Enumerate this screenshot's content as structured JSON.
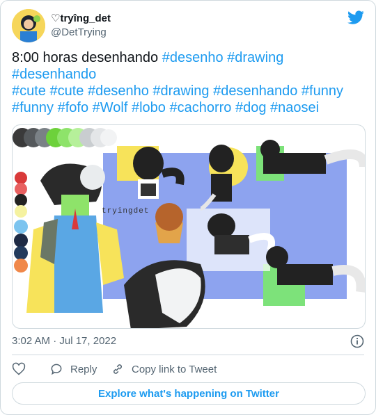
{
  "author": {
    "display_name": "♡tryîng_det",
    "handle": "@DetTrying"
  },
  "tweet": {
    "lines": [
      {
        "plain": "8:00 horas desenhando ",
        "tags": "#desenho #drawing"
      },
      {
        "plain": "",
        "tags": "#desenhando"
      },
      {
        "plain": "",
        "tags": "#cute #cute #desenho #drawing #desenhando #funny"
      },
      {
        "plain": "",
        "tags": "#funny #fofo #Wolf #lobo #cachorro #dog #naosei"
      }
    ]
  },
  "media": {
    "watermark": "tryingdet",
    "palette_colors": [
      "#3a3a3a",
      "#55595c",
      "#7a8186",
      "#a6aeb3",
      "#6dd13b",
      "#8ee36a",
      "#b6f09a",
      "#c9cdd0",
      "#e4e6e8",
      "#f2f3f4"
    ],
    "side_palette": [
      "#d93a3a",
      "#e86060",
      "#222222",
      "#f5f2a0",
      "#7cc4ef",
      "#1e2a44",
      "#223a5c",
      "#f1b98a",
      "#f0884a"
    ],
    "accent_colors": {
      "blue_bg": "#8da3ef",
      "yellow": "#f7e35a",
      "green": "#7de27a",
      "white": "#ffffff"
    }
  },
  "meta": {
    "timestamp": "3:02 AM · Jul 17, 2022"
  },
  "actions": {
    "reply": "Reply",
    "copy": "Copy link to Tweet"
  },
  "explore": {
    "label": "Explore what's happening on Twitter"
  },
  "colors": {
    "accent": "#1d9bf0",
    "text": "#0f1419",
    "muted": "#536471",
    "border": "#cfd9de"
  },
  "icons": {
    "bird": "twitter-bird-icon",
    "info": "info-icon",
    "like": "heart-icon",
    "reply": "reply-bubble-icon",
    "copy": "link-icon"
  }
}
